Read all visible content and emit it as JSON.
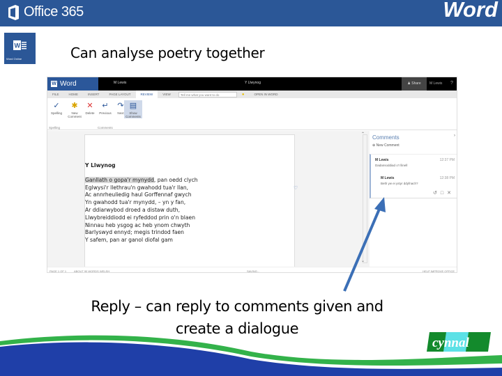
{
  "header": {
    "brand": "Office 365",
    "app_title": "Word",
    "brand_color": "#2b5797"
  },
  "app_tile": {
    "label": "Word Online"
  },
  "headline": "Can analyse poetry together",
  "word_online": {
    "app_name": "Word Online",
    "user": "M Lewis",
    "doc_title": "Y Llwynog",
    "share": "Share",
    "help": "?",
    "tabs": [
      "FILE",
      "HOME",
      "INSERT",
      "PAGE LAYOUT",
      "REVIEW",
      "VIEW"
    ],
    "active_tab": "REVIEW",
    "tell_me_placeholder": "Tell me what you want to do",
    "open_in_word": "OPEN IN WORD",
    "ribbon": {
      "spelling": "Spelling",
      "new_comment": "New Comment",
      "delete": "Delete",
      "previous": "Previous",
      "next": "Next",
      "show_comments": "Show Comments",
      "group_spelling": "Spelling",
      "group_comments": "Comments"
    },
    "poem": {
      "title": "Y Llwynog",
      "highlighted": "Ganllath o gopa'r mynydd",
      "first_line_rest": ", pan oedd clych",
      "lines": [
        "Eglwysi'r llethrau'n gwahodd tua'r llan,",
        "Ac annrheuliedig haul Gorffennaf gwych",
        "Yn gwahodd tua'r mynydd, – yn y fan,",
        "Ar ddiarwybod droed a distaw duth,",
        "Llwybreiddiodd ei ryfeddod prin o'n blaen",
        "Ninnau heb ysgog ac heb ynom chwyth",
        "Barlyswyd ennyd; megis trindod faen",
        "Y safem, pan ar ganol diofal gam"
      ]
    },
    "comments_pane": {
      "title": "Comments",
      "new_comment": "New Comment",
      "items": [
        {
          "author": "M Lewis",
          "time": "12:37 PM",
          "text": "Dadansoddiad o'r llinell"
        },
        {
          "author": "M Lewis",
          "time": "12:38 PM",
          "text": "Beth yw ei ystyr ddyfnach?"
        }
      ]
    },
    "status": {
      "page": "PAGE 1 OF 1",
      "words": "ABOUT 90 WORDS",
      "lang": "WELSH",
      "saving": "SAVING...",
      "help": "HELP IMPROVE OFFICE"
    }
  },
  "caption": {
    "line1": "Reply – can reply to comments given and",
    "line2": "create a dialogue"
  },
  "footer": {
    "logo_text": "cynnal",
    "wave_blue": "#1f3fa8",
    "wave_green": "#33b24a"
  }
}
